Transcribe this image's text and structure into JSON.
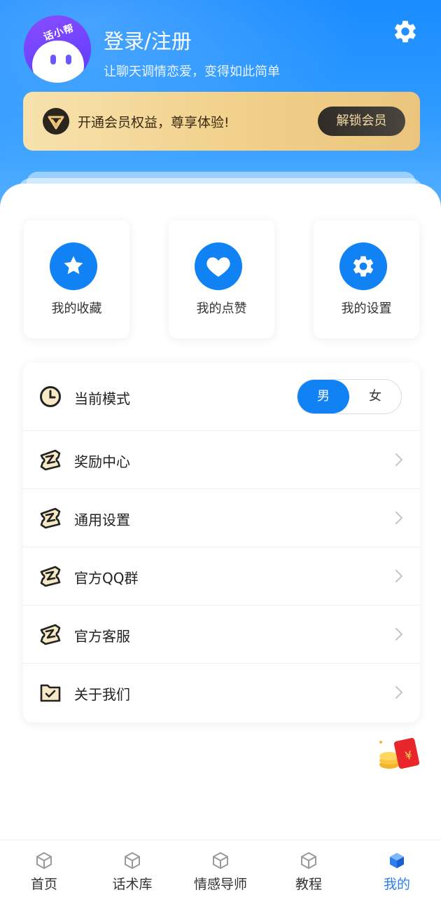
{
  "profile": {
    "avatar_badge": "话小帮",
    "title": "登录/注册",
    "subtitle": "让聊天调情恋爱，变得如此简单"
  },
  "vip": {
    "text": "开通会员权益，尊享体验!",
    "button": "解锁会员"
  },
  "quick_actions": [
    {
      "label": "我的收藏",
      "icon": "star-icon"
    },
    {
      "label": "我的点赞",
      "icon": "heart-icon"
    },
    {
      "label": "我的设置",
      "icon": "gear-icon"
    }
  ],
  "menu": {
    "mode": {
      "label": "当前模式",
      "options": [
        "男",
        "女"
      ],
      "selected": "男"
    },
    "items": [
      {
        "label": "奖励中心",
        "icon": "ticket-icon"
      },
      {
        "label": "通用设置",
        "icon": "ticket-icon"
      },
      {
        "label": "官方QQ群",
        "icon": "ticket-icon"
      },
      {
        "label": "官方客服",
        "icon": "ticket-icon"
      },
      {
        "label": "关于我们",
        "icon": "folder-check-icon"
      }
    ]
  },
  "tabs": [
    {
      "label": "首页",
      "active": false
    },
    {
      "label": "话术库",
      "active": false
    },
    {
      "label": "情感导师",
      "active": false
    },
    {
      "label": "教程",
      "active": false
    },
    {
      "label": "我的",
      "active": true
    }
  ],
  "colors": {
    "primary": "#1182f3",
    "header_blue": "#1a8cff",
    "vip_gold": "#f1d08a",
    "active_tab": "#2b7df0"
  }
}
